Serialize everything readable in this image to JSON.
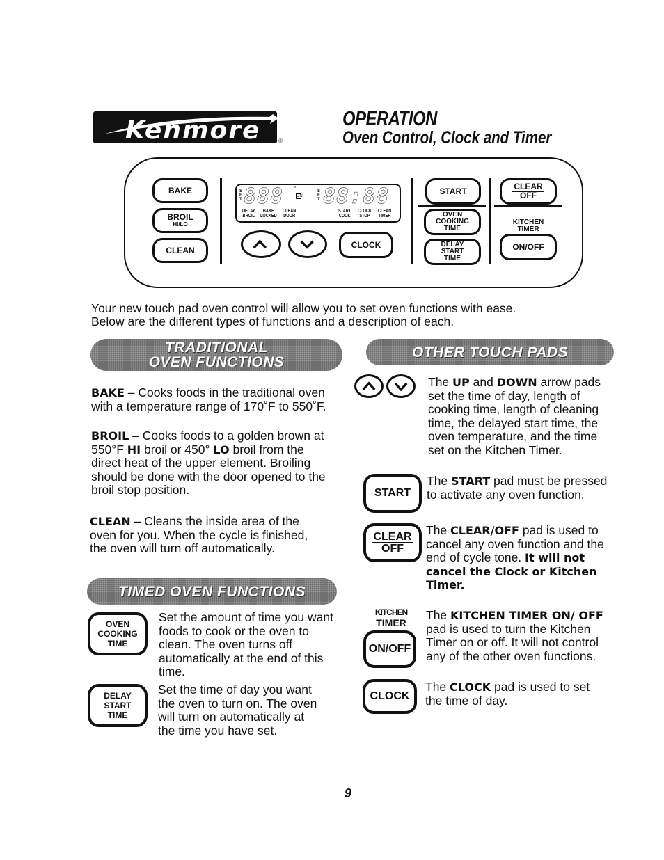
{
  "header": {
    "brand": "Kenmore",
    "registered_mark": "®",
    "title": "OPERATION",
    "subtitle": "Oven Control, Clock and Timer"
  },
  "control_panel": {
    "pads": {
      "bake": "BAKE",
      "broil": "BROIL",
      "broil_sub": "HI/LO",
      "clean": "CLEAN",
      "clock": "CLOCK",
      "start": "START",
      "oven_cooking_time": [
        "OVEN",
        "COOKING",
        "TIME"
      ],
      "delay_start_time": [
        "DELAY",
        "START",
        "TIME"
      ],
      "clear": "CLEAR",
      "off": "OFF",
      "kitchen_timer_label": [
        "KITCHEN",
        "TIMER"
      ],
      "on_off": "ON/OFF"
    },
    "display": {
      "temp_digits": "888",
      "time_digits": "88:88",
      "set_label": "SET",
      "degree": "°",
      "dn_indicator": "DN",
      "labels": [
        [
          "DELAY",
          "BROIL"
        ],
        [
          "BAKE",
          "LOCKED"
        ],
        [
          "CLEAN",
          "DOOR"
        ],
        [
          "START",
          "COOK"
        ],
        [
          "CLOCK",
          "STOP"
        ],
        [
          "CLEAN",
          "TIMER"
        ]
      ]
    },
    "icons": {
      "up": "up-arrow-icon",
      "down": "down-arrow-icon"
    }
  },
  "intro": {
    "line1": "Your new touch pad oven control will allow you to set oven functions with ease.",
    "line2": "Below are the different types of functions and a description of each."
  },
  "traditional": {
    "banner": [
      "TRADITIONAL",
      "OVEN FUNCTIONS"
    ],
    "bake": {
      "term": "BAKE",
      "text": " – Cooks foods in the traditional oven with a temperature range of 170˚F to 550˚F."
    },
    "broil": {
      "term": "BROIL",
      "text1": " – Cooks foods to a golden brown at 550°F ",
      "hi": "HI",
      "text2": " broil or 450° ",
      "lo": "LO",
      "text3": " broil from the direct heat of the upper element. Broiling should be done with the door opened to the broil stop position."
    },
    "clean": {
      "term": "CLEAN",
      "text": " – Cleans the inside area of the oven for you. When the cycle is finished, the oven will turn off automatically."
    }
  },
  "timed": {
    "banner": "TIMED OVEN FUNCTIONS",
    "items": [
      {
        "pad": [
          "OVEN",
          "COOKING",
          "TIME"
        ],
        "text": "Set the amount of time you want foods to cook or the oven to clean. The oven turns off automatically at the end of this time."
      },
      {
        "pad": [
          "DELAY",
          "START",
          "TIME"
        ],
        "text": "Set the time of day you want the oven to turn on. The oven will turn on automatically at the time you have set."
      }
    ]
  },
  "other": {
    "banner": "OTHER TOUCH PADS",
    "updown": {
      "pre": "The ",
      "up": "UP",
      "mid": " and ",
      "down": "DOWN",
      "text": " arrow pads set the time of day, length of cooking time, length of cleaning time, the delayed start time, the oven temperature, and the time set on the Kitchen Timer."
    },
    "start": {
      "pad": "START",
      "pre": "The ",
      "term": "START",
      "text": " pad must be pressed to activate any oven function."
    },
    "clear": {
      "pad_top": "CLEAR",
      "pad_bottom": "OFF",
      "pre": "The ",
      "term": "CLEAR/OFF",
      "text": " pad is used to cancel any oven function and the end of cycle tone. ",
      "bold": "It will not cancel the Clock or Kitchen Timer."
    },
    "timer": {
      "label1": "KITCHEN",
      "label2": "TIMER",
      "pad": "ON/OFF",
      "pre": "The ",
      "term": "KITCHEN TIMER ON/ OFF",
      "text": " pad is used to turn the Kitchen Timer on or off. It will not control any of the other oven functions."
    },
    "clock": {
      "pad": "CLOCK",
      "pre": "The ",
      "term": "CLOCK",
      "text": " pad is used to set the time of day."
    }
  },
  "page_number": "9"
}
